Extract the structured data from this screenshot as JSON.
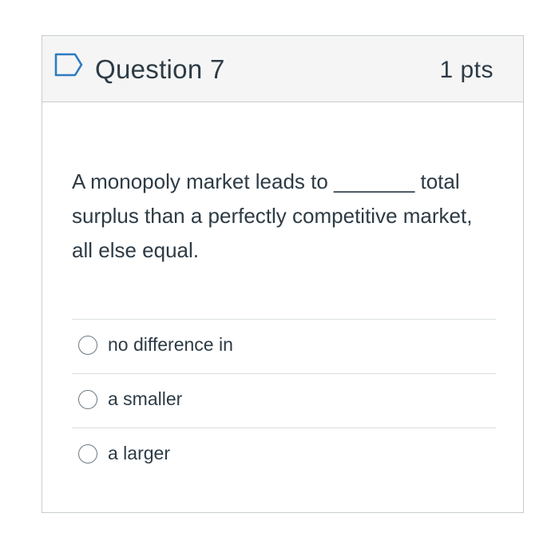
{
  "question": {
    "title": "Question 7",
    "points": "1 pts",
    "text": "A monopoly market leads to  _______ total surplus than a perfectly competitive market, all else equal.",
    "flag_icon": "flag-outline-icon",
    "accent_color": "#2d7bbf"
  },
  "answers": [
    {
      "label": "no difference in",
      "selected": false
    },
    {
      "label": "a smaller",
      "selected": false
    },
    {
      "label": "a larger",
      "selected": false
    }
  ]
}
